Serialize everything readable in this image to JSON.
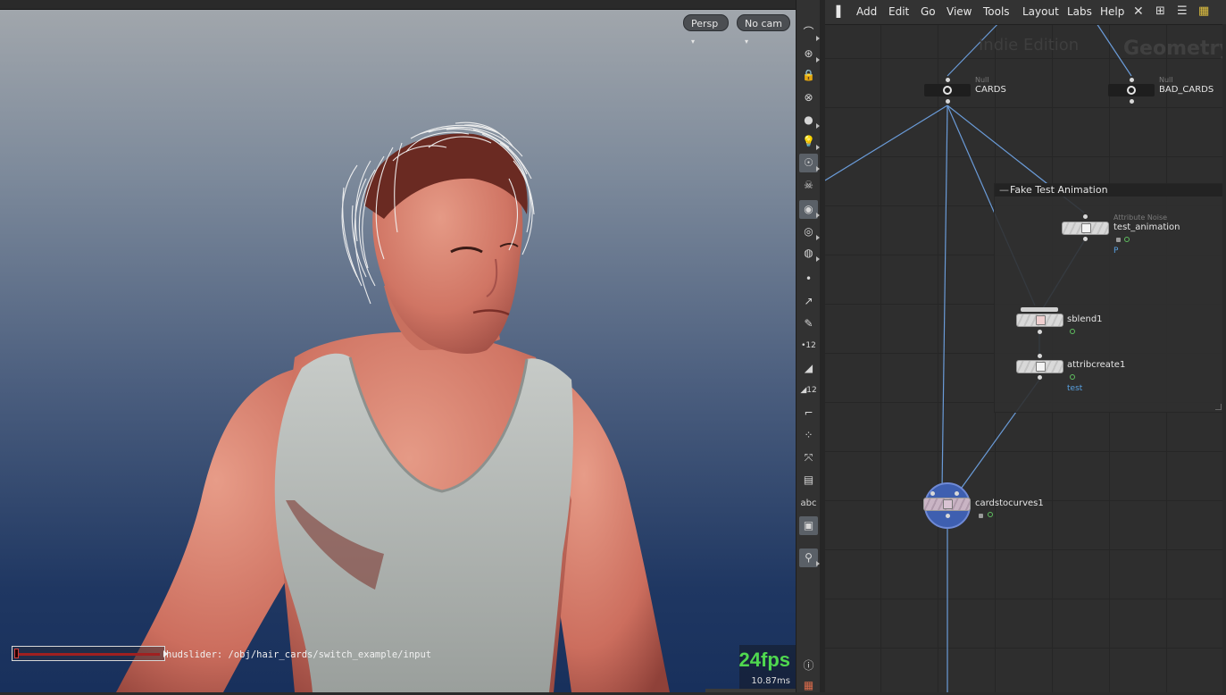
{
  "viewport": {
    "camera_mode": "Persp",
    "camera_select": "No cam",
    "hud_slider_label": "hudslider: /obj/hair_cards/switch_example/input",
    "fps": "24fps",
    "frame_time": "10.87ms"
  },
  "shelf": {
    "tools": [
      {
        "name": "visibility-tool"
      },
      {
        "name": "template-tool"
      },
      {
        "name": "lock-icon"
      },
      {
        "name": "close-geometry-icon"
      },
      {
        "name": "shading-sphere-icon"
      },
      {
        "name": "light-bulb-icon"
      },
      {
        "name": "headlight-icon"
      },
      {
        "name": "skull-icon"
      },
      {
        "name": "face-icon"
      },
      {
        "name": "eye-icon"
      },
      {
        "name": "eye-lock-icon"
      },
      {
        "name": "point-icon"
      },
      {
        "name": "point-normal-icon"
      },
      {
        "name": "brush-icon"
      },
      {
        "name": "point-number-icon",
        "label": "12"
      },
      {
        "name": "primitive-icon"
      },
      {
        "name": "primitive-number-icon",
        "label": "12"
      },
      {
        "name": "edge-icon"
      },
      {
        "name": "vertex-icon"
      },
      {
        "name": "normal-icon"
      },
      {
        "name": "bounding-box-icon"
      },
      {
        "name": "text-abc-icon",
        "label": "abc"
      },
      {
        "name": "background-image-icon"
      },
      {
        "name": "pin-icon"
      },
      {
        "name": "info-icon"
      },
      {
        "name": "grid-icon"
      }
    ]
  },
  "network": {
    "menu": [
      "Add",
      "Edit",
      "Go",
      "View",
      "Tools",
      "Layout",
      "Labs",
      "Help"
    ],
    "watermark_edition": "Indie Edition",
    "watermark_context": "Geometry",
    "netbox_title": "Fake Test Animation",
    "nodes": {
      "cards": {
        "type": "Null",
        "name": "CARDS"
      },
      "bad_cards": {
        "type": "Null",
        "name": "BAD_CARDS"
      },
      "test_animation": {
        "type": "Attribute Noise",
        "name": "test_animation",
        "flag": "P"
      },
      "sblend": {
        "name": "sblend1"
      },
      "attribcreate": {
        "name": "attribcreate1",
        "flag": "test"
      },
      "cardstocurves": {
        "name": "cardstocurves1"
      }
    },
    "colors": {
      "wire": "#6a9bd8",
      "selected": "#3e5fb0"
    }
  }
}
